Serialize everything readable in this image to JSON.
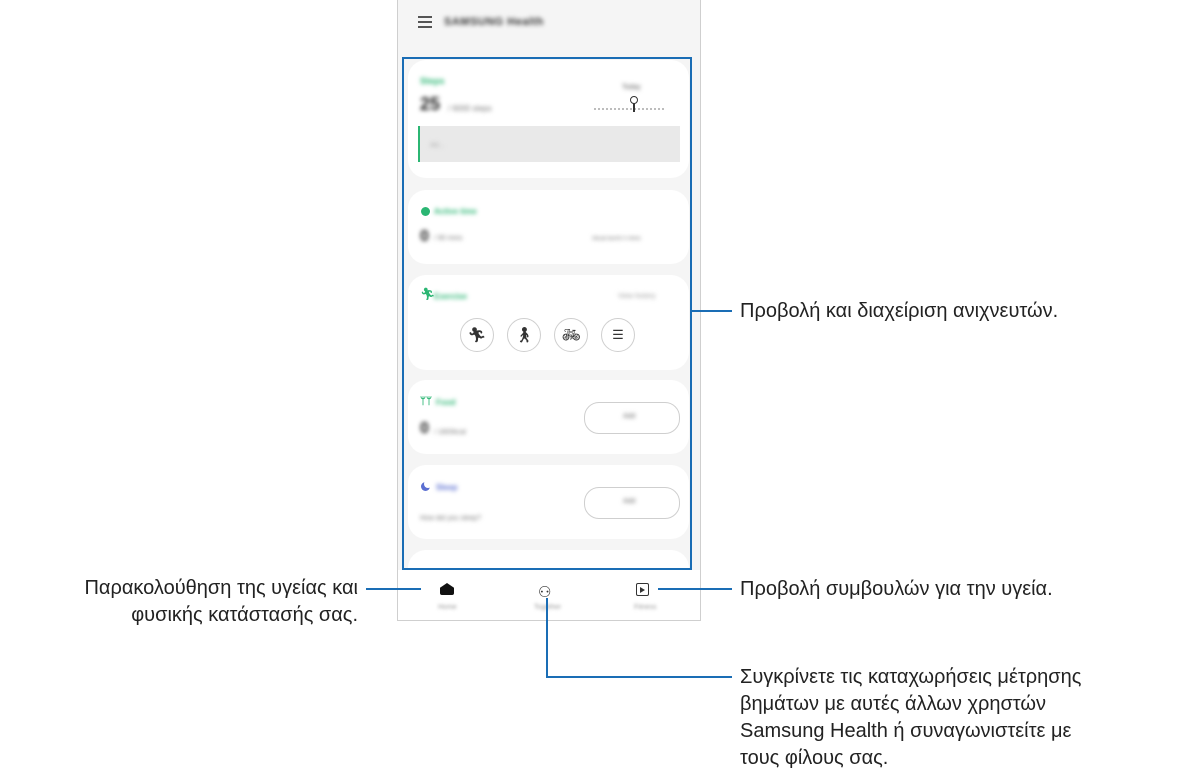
{
  "app": {
    "title": "SAMSUNG Health"
  },
  "cards": {
    "steps": {
      "title": "Steps",
      "value": "25",
      "goal": "/ 6000 steps",
      "today": "Today",
      "note": "Ad..."
    },
    "active_time": {
      "title": "Active time",
      "value": "0",
      "goal": "/ 90 mins",
      "extra": "0kcal burnt  0 mins"
    },
    "exercise": {
      "title": "Exercise",
      "link": "View history"
    },
    "food": {
      "title": "Food",
      "value": "0",
      "goal": "/ 1800kcal",
      "button": "Add"
    },
    "sleep": {
      "title": "Sleep",
      "question": "How did you sleep?",
      "button": "Add"
    }
  },
  "nav": {
    "home": "Home",
    "together": "Together",
    "fitness": "Fitness"
  },
  "callouts": {
    "trackers": "Προβολή και διαχείριση ανιχνευτών.",
    "tips": "Προβολή συμβουλών για την υγεία.",
    "home_line1": "Παρακολούθηση της υγείας και",
    "home_line2": "φυσικής κατάστασής σας.",
    "together_line1": "Συγκρίνετε τις καταχωρήσεις μέτρησης",
    "together_line2": "βημάτων με αυτές άλλων χρηστών",
    "together_line3": "Samsung Health ή συναγωνιστείτε με",
    "together_line4": "τους φίλους σας."
  },
  "colors": {
    "accent": "#2bb673",
    "callout_line": "#1a6db5",
    "sleep": "#5b6fd1"
  },
  "icons": [
    "menu-icon",
    "clock-icon",
    "running-icon",
    "walking-icon",
    "cycling-icon",
    "list-icon",
    "cutlery-icon",
    "moon-icon",
    "home-icon",
    "people-icon",
    "calendar-play-icon"
  ]
}
